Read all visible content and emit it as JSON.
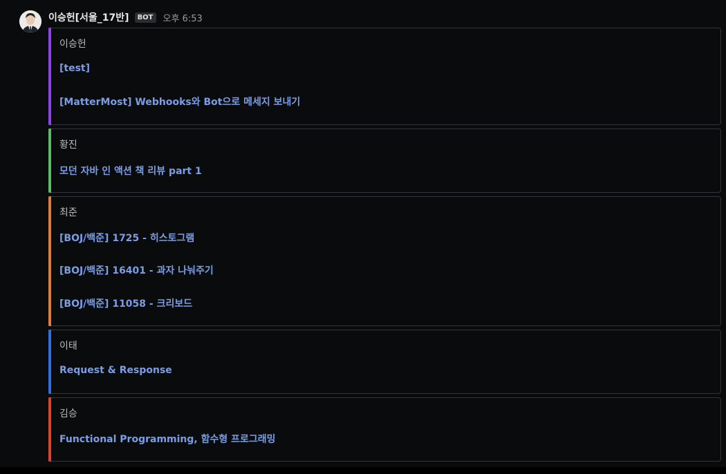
{
  "post": {
    "username": "이승헌[서울_17반]",
    "bot_badge": "BOT",
    "time": "오후 6:53"
  },
  "colors": {
    "purple": "#8e44e8",
    "green": "#5dbb63",
    "orange": "#e07b39",
    "blue": "#2f6fe0",
    "red": "#d9452b",
    "link": "#7a9ee6"
  },
  "attachments": [
    {
      "author": "이승헌",
      "links": [
        "[test]",
        "[MatterMost] Webhooks와 Bot으로 메세지 보내기"
      ]
    },
    {
      "author": "황진",
      "links": [
        "모던 자바 인 액션 책 리뷰 part 1"
      ]
    },
    {
      "author": "최준",
      "links": [
        "[BOJ/백준] 1725 - 히스토그램",
        "[BOJ/백준] 16401 - 과자 나눠주기",
        "[BOJ/백준] 11058 - 크리보드"
      ]
    },
    {
      "author": "이태",
      "links": [
        "Request & Response"
      ]
    },
    {
      "author": "김승",
      "links": [
        "Functional Programming, 함수형 프로그래밍"
      ]
    }
  ]
}
